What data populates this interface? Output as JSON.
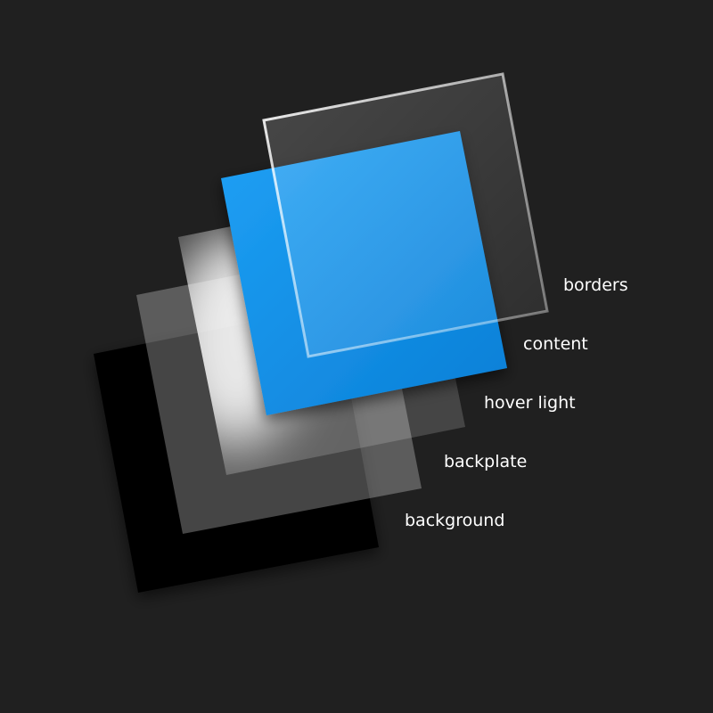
{
  "layers": [
    {
      "key": "borders",
      "label": "borders"
    },
    {
      "key": "content",
      "label": "content"
    },
    {
      "key": "hover",
      "label": "hover light"
    },
    {
      "key": "backplate",
      "label": "backplate"
    },
    {
      "key": "background",
      "label": "background"
    }
  ],
  "colors": {
    "canvas": "#202020",
    "background_layer": "#000000",
    "backplate": "#ffffff",
    "hover_light": "#ffffff",
    "content": "#0a8ae8",
    "border_highlight": "#ffffff"
  }
}
